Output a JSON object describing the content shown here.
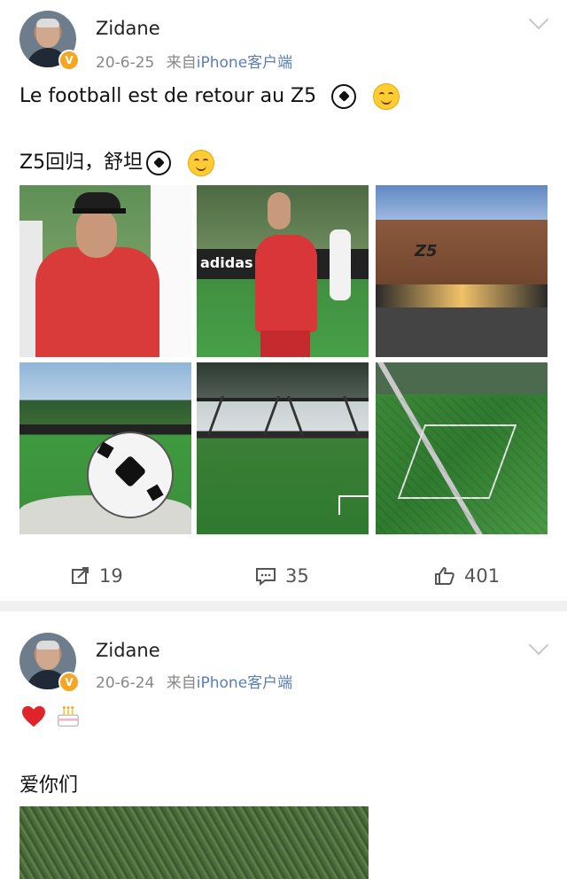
{
  "posts": [
    {
      "user": "Zidane",
      "date": "20-6-25",
      "source_prefix": "来自",
      "source_app": "iPhone客户端",
      "text_line1": "Le football est de retour au Z5",
      "text_line2": "Z5回归，舒坦",
      "images": [
        {
          "subject": "zidane-red-shirt-cap"
        },
        {
          "subject": "zidane-walking-pitch"
        },
        {
          "subject": "z5-building-sunset"
        },
        {
          "subject": "adidas-ball-on-turf"
        },
        {
          "subject": "indoor-pitch"
        },
        {
          "subject": "pitch-aerial-view"
        }
      ],
      "building_sign": "Z5",
      "ad_text": "adidas",
      "actions": {
        "repost": "19",
        "comment": "35",
        "like": "401"
      }
    },
    {
      "user": "Zidane",
      "date": "20-6-24",
      "source_prefix": "来自",
      "source_app": "iPhone客户端",
      "text_line2": "爱你们"
    }
  ],
  "colors": {
    "verified_badge": "#f5a623",
    "source_link": "#5a7fb0",
    "separator": "#f0f0f0"
  }
}
